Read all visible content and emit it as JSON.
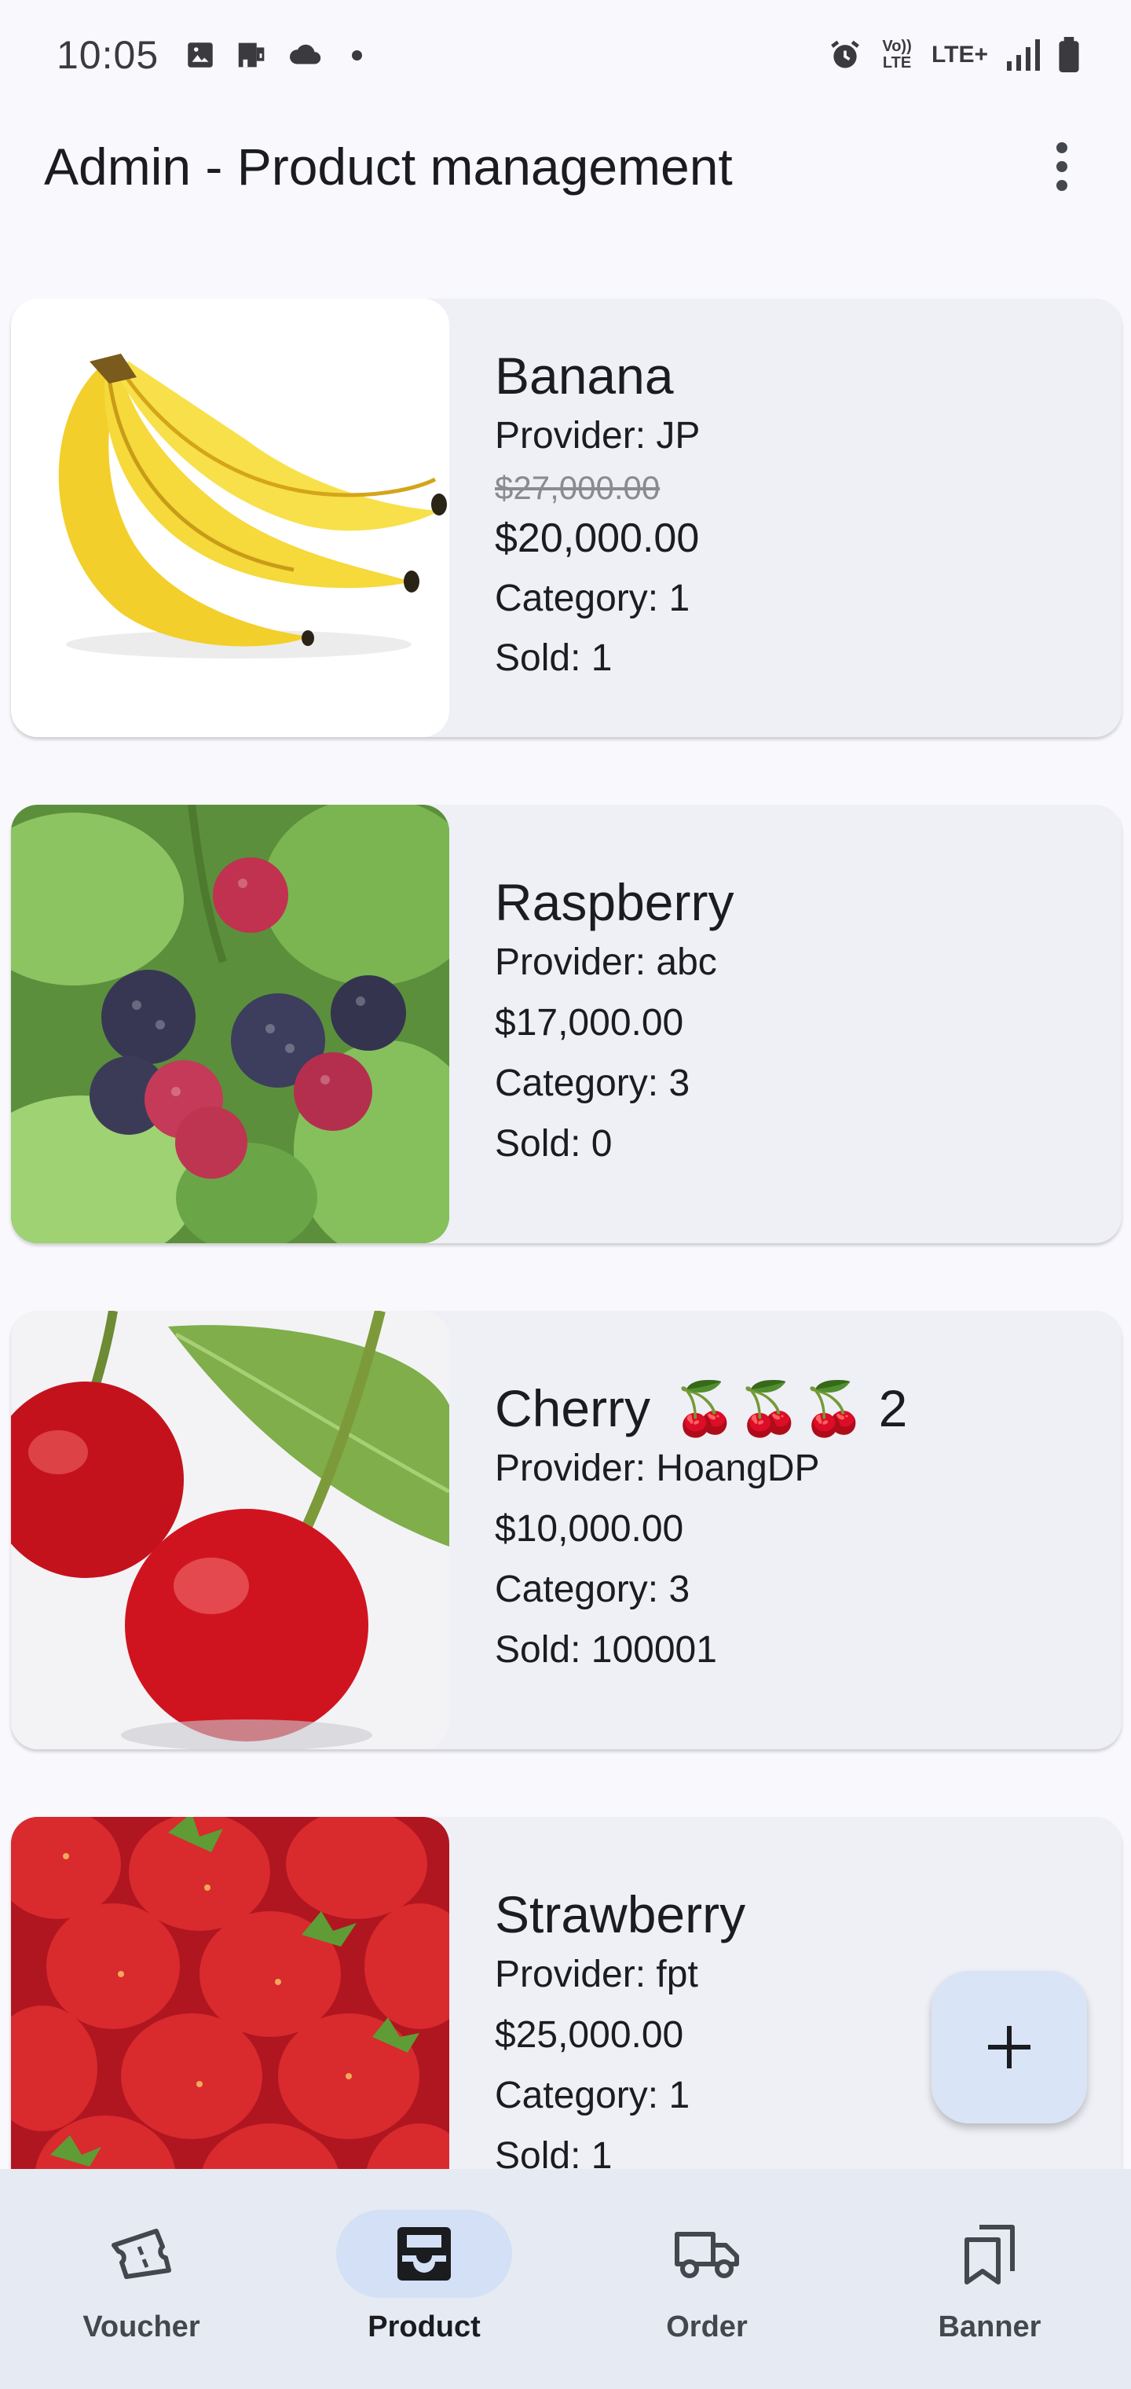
{
  "status_bar": {
    "time": "10:05",
    "icons_left": [
      "image-icon",
      "sim-icon",
      "cloud-icon",
      "dot-icon"
    ],
    "lte_label": "LTE+",
    "volte_label": "Vo)) LTE"
  },
  "app_bar": {
    "title": "Admin - Product management",
    "menu_icon": "more-vert-icon"
  },
  "products": [
    {
      "name": "Banana",
      "provider": "Provider: JP",
      "old_price": "$27,000.00",
      "price": "$20,000.00",
      "category": "Category: 1",
      "sold": "Sold: 1"
    },
    {
      "name": "Raspberry",
      "provider": "Provider: abc",
      "price": "$17,000.00",
      "category": "Category: 3",
      "sold": "Sold: 0"
    },
    {
      "name": "Cherry",
      "badge_count": "2",
      "badge_icons": "🍒🍒🍒",
      "provider": "Provider: HoangDP",
      "price": "$10,000.00",
      "category": "Category: 3",
      "sold": "Sold: 100001"
    },
    {
      "name": "Strawberry",
      "provider": "Provider: fpt",
      "price": "$25,000.00",
      "category": "Category: 1",
      "sold": "Sold: 1"
    }
  ],
  "fab": {
    "icon": "plus-icon"
  },
  "nav": [
    {
      "label": "Voucher",
      "icon": "voucher-icon",
      "active": false
    },
    {
      "label": "Product",
      "icon": "inbox-icon",
      "active": true
    },
    {
      "label": "Order",
      "icon": "truck-icon",
      "active": false
    },
    {
      "label": "Banner",
      "icon": "bookmarks-icon",
      "active": false
    }
  ],
  "colors": {
    "background": "#f9f9fd",
    "card": "#eef0f5",
    "fab": "#d9e4f7",
    "nav_bar": "#e6ebf3",
    "nav_active_pill": "#d3e0f5"
  }
}
